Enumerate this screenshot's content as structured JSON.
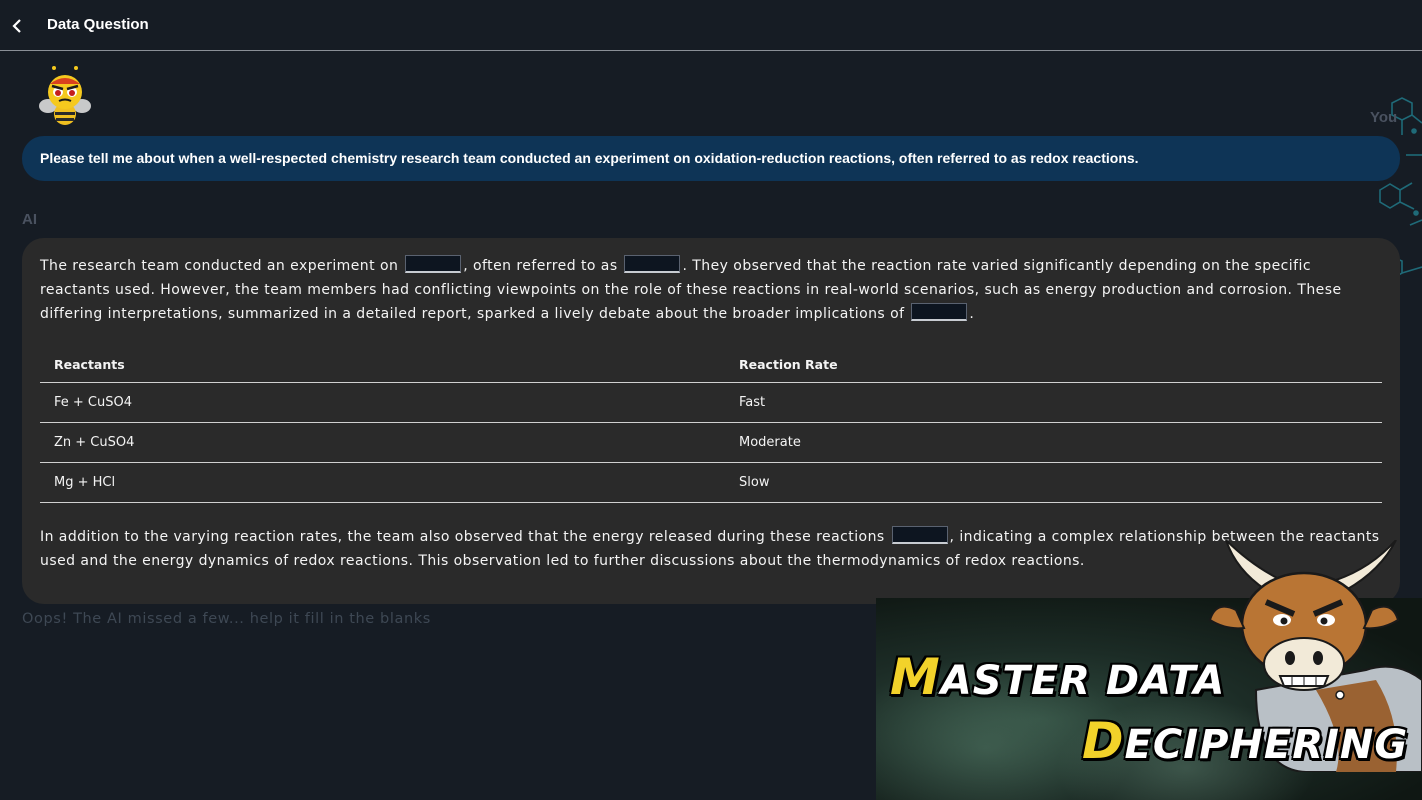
{
  "header": {
    "title": "Data Question",
    "back_icon": "chevron-left-icon"
  },
  "chat": {
    "user_label": "You",
    "user_message": "Please tell me about when a well-respected chemistry research team conducted an experiment on oxidation-reduction reactions, often referred to as redox reactions.",
    "ai_label": "AI",
    "paragraph1": {
      "part1": "The research team conducted an experiment on ",
      "part2": ", often referred to as ",
      "part3": ". They observed that the reaction rate varied significantly depending on the specific reactants used. However, the team members had conflicting viewpoints on the role of these reactions in real-world scenarios, such as energy production and corrosion. These differing interpretations, summarized in a detailed report, sparked a lively debate about the broader implications of ",
      "part4": "."
    },
    "table": {
      "headers": [
        "Reactants",
        "Reaction Rate"
      ],
      "rows": [
        [
          "Fe + CuSO4",
          "Fast"
        ],
        [
          "Zn + CuSO4",
          "Moderate"
        ],
        [
          "Mg + HCl",
          "Slow"
        ]
      ]
    },
    "paragraph2": {
      "part1": "In addition to the varying reaction rates, the team also observed that the energy released during these reactions ",
      "part2": ", indicating a complex relationship between the reactants used and the energy dynamics of redox reactions. This observation led to further discussions about the thermodynamics of redox reactions."
    },
    "hint": "Oops! The AI missed a few... help it fill in the blanks"
  },
  "promo": {
    "line1_cap": "M",
    "line1_rest": "ASTER DATA",
    "line2_cap": "D",
    "line2_rest": "ECIPHERING"
  },
  "colors": {
    "background": "#161c24",
    "user_bubble": "#0e3456",
    "ai_bubble": "#2a2a2a",
    "promo_accent": "#f2d22a"
  }
}
